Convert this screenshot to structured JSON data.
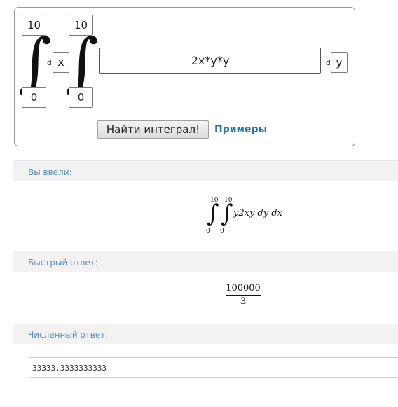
{
  "calculator": {
    "outer_integral": {
      "upper": "10",
      "lower": "0",
      "variable": "x",
      "d_label": "d"
    },
    "inner_integral": {
      "upper": "10",
      "lower": "0",
      "variable": "y",
      "d_label": "d"
    },
    "integral_symbol": "∫",
    "expression": "2x*y*y",
    "find_button": "Найти интеграл!",
    "examples_link": "Примеры"
  },
  "results": {
    "you_entered_label": "Вы ввели:",
    "you_entered": {
      "upper_outer": "10",
      "lower_outer": "0",
      "upper_inner": "10",
      "lower_inner": "0",
      "integrand": "y2xy dy dx"
    },
    "quick_answer_label": "Быстрый ответ:",
    "quick_answer": {
      "numerator": "100000",
      "denominator": "3"
    },
    "numeric_answer_label": "Численный ответ:",
    "numeric_answer": "33333.3333333333"
  }
}
